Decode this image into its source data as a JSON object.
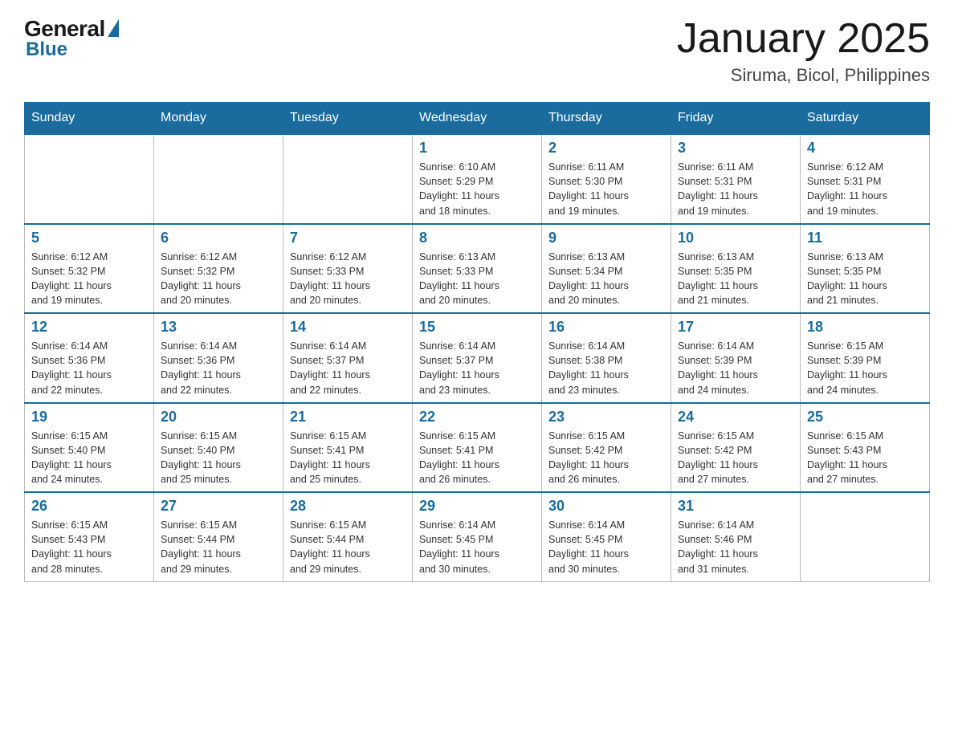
{
  "header": {
    "logo_general": "General",
    "logo_blue": "Blue",
    "main_title": "January 2025",
    "subtitle": "Siruma, Bicol, Philippines"
  },
  "days_of_week": [
    "Sunday",
    "Monday",
    "Tuesday",
    "Wednesday",
    "Thursday",
    "Friday",
    "Saturday"
  ],
  "weeks": [
    [
      {
        "day": "",
        "info": ""
      },
      {
        "day": "",
        "info": ""
      },
      {
        "day": "",
        "info": ""
      },
      {
        "day": "1",
        "info": "Sunrise: 6:10 AM\nSunset: 5:29 PM\nDaylight: 11 hours\nand 18 minutes."
      },
      {
        "day": "2",
        "info": "Sunrise: 6:11 AM\nSunset: 5:30 PM\nDaylight: 11 hours\nand 19 minutes."
      },
      {
        "day": "3",
        "info": "Sunrise: 6:11 AM\nSunset: 5:31 PM\nDaylight: 11 hours\nand 19 minutes."
      },
      {
        "day": "4",
        "info": "Sunrise: 6:12 AM\nSunset: 5:31 PM\nDaylight: 11 hours\nand 19 minutes."
      }
    ],
    [
      {
        "day": "5",
        "info": "Sunrise: 6:12 AM\nSunset: 5:32 PM\nDaylight: 11 hours\nand 19 minutes."
      },
      {
        "day": "6",
        "info": "Sunrise: 6:12 AM\nSunset: 5:32 PM\nDaylight: 11 hours\nand 20 minutes."
      },
      {
        "day": "7",
        "info": "Sunrise: 6:12 AM\nSunset: 5:33 PM\nDaylight: 11 hours\nand 20 minutes."
      },
      {
        "day": "8",
        "info": "Sunrise: 6:13 AM\nSunset: 5:33 PM\nDaylight: 11 hours\nand 20 minutes."
      },
      {
        "day": "9",
        "info": "Sunrise: 6:13 AM\nSunset: 5:34 PM\nDaylight: 11 hours\nand 20 minutes."
      },
      {
        "day": "10",
        "info": "Sunrise: 6:13 AM\nSunset: 5:35 PM\nDaylight: 11 hours\nand 21 minutes."
      },
      {
        "day": "11",
        "info": "Sunrise: 6:13 AM\nSunset: 5:35 PM\nDaylight: 11 hours\nand 21 minutes."
      }
    ],
    [
      {
        "day": "12",
        "info": "Sunrise: 6:14 AM\nSunset: 5:36 PM\nDaylight: 11 hours\nand 22 minutes."
      },
      {
        "day": "13",
        "info": "Sunrise: 6:14 AM\nSunset: 5:36 PM\nDaylight: 11 hours\nand 22 minutes."
      },
      {
        "day": "14",
        "info": "Sunrise: 6:14 AM\nSunset: 5:37 PM\nDaylight: 11 hours\nand 22 minutes."
      },
      {
        "day": "15",
        "info": "Sunrise: 6:14 AM\nSunset: 5:37 PM\nDaylight: 11 hours\nand 23 minutes."
      },
      {
        "day": "16",
        "info": "Sunrise: 6:14 AM\nSunset: 5:38 PM\nDaylight: 11 hours\nand 23 minutes."
      },
      {
        "day": "17",
        "info": "Sunrise: 6:14 AM\nSunset: 5:39 PM\nDaylight: 11 hours\nand 24 minutes."
      },
      {
        "day": "18",
        "info": "Sunrise: 6:15 AM\nSunset: 5:39 PM\nDaylight: 11 hours\nand 24 minutes."
      }
    ],
    [
      {
        "day": "19",
        "info": "Sunrise: 6:15 AM\nSunset: 5:40 PM\nDaylight: 11 hours\nand 24 minutes."
      },
      {
        "day": "20",
        "info": "Sunrise: 6:15 AM\nSunset: 5:40 PM\nDaylight: 11 hours\nand 25 minutes."
      },
      {
        "day": "21",
        "info": "Sunrise: 6:15 AM\nSunset: 5:41 PM\nDaylight: 11 hours\nand 25 minutes."
      },
      {
        "day": "22",
        "info": "Sunrise: 6:15 AM\nSunset: 5:41 PM\nDaylight: 11 hours\nand 26 minutes."
      },
      {
        "day": "23",
        "info": "Sunrise: 6:15 AM\nSunset: 5:42 PM\nDaylight: 11 hours\nand 26 minutes."
      },
      {
        "day": "24",
        "info": "Sunrise: 6:15 AM\nSunset: 5:42 PM\nDaylight: 11 hours\nand 27 minutes."
      },
      {
        "day": "25",
        "info": "Sunrise: 6:15 AM\nSunset: 5:43 PM\nDaylight: 11 hours\nand 27 minutes."
      }
    ],
    [
      {
        "day": "26",
        "info": "Sunrise: 6:15 AM\nSunset: 5:43 PM\nDaylight: 11 hours\nand 28 minutes."
      },
      {
        "day": "27",
        "info": "Sunrise: 6:15 AM\nSunset: 5:44 PM\nDaylight: 11 hours\nand 29 minutes."
      },
      {
        "day": "28",
        "info": "Sunrise: 6:15 AM\nSunset: 5:44 PM\nDaylight: 11 hours\nand 29 minutes."
      },
      {
        "day": "29",
        "info": "Sunrise: 6:14 AM\nSunset: 5:45 PM\nDaylight: 11 hours\nand 30 minutes."
      },
      {
        "day": "30",
        "info": "Sunrise: 6:14 AM\nSunset: 5:45 PM\nDaylight: 11 hours\nand 30 minutes."
      },
      {
        "day": "31",
        "info": "Sunrise: 6:14 AM\nSunset: 5:46 PM\nDaylight: 11 hours\nand 31 minutes."
      },
      {
        "day": "",
        "info": ""
      }
    ]
  ]
}
